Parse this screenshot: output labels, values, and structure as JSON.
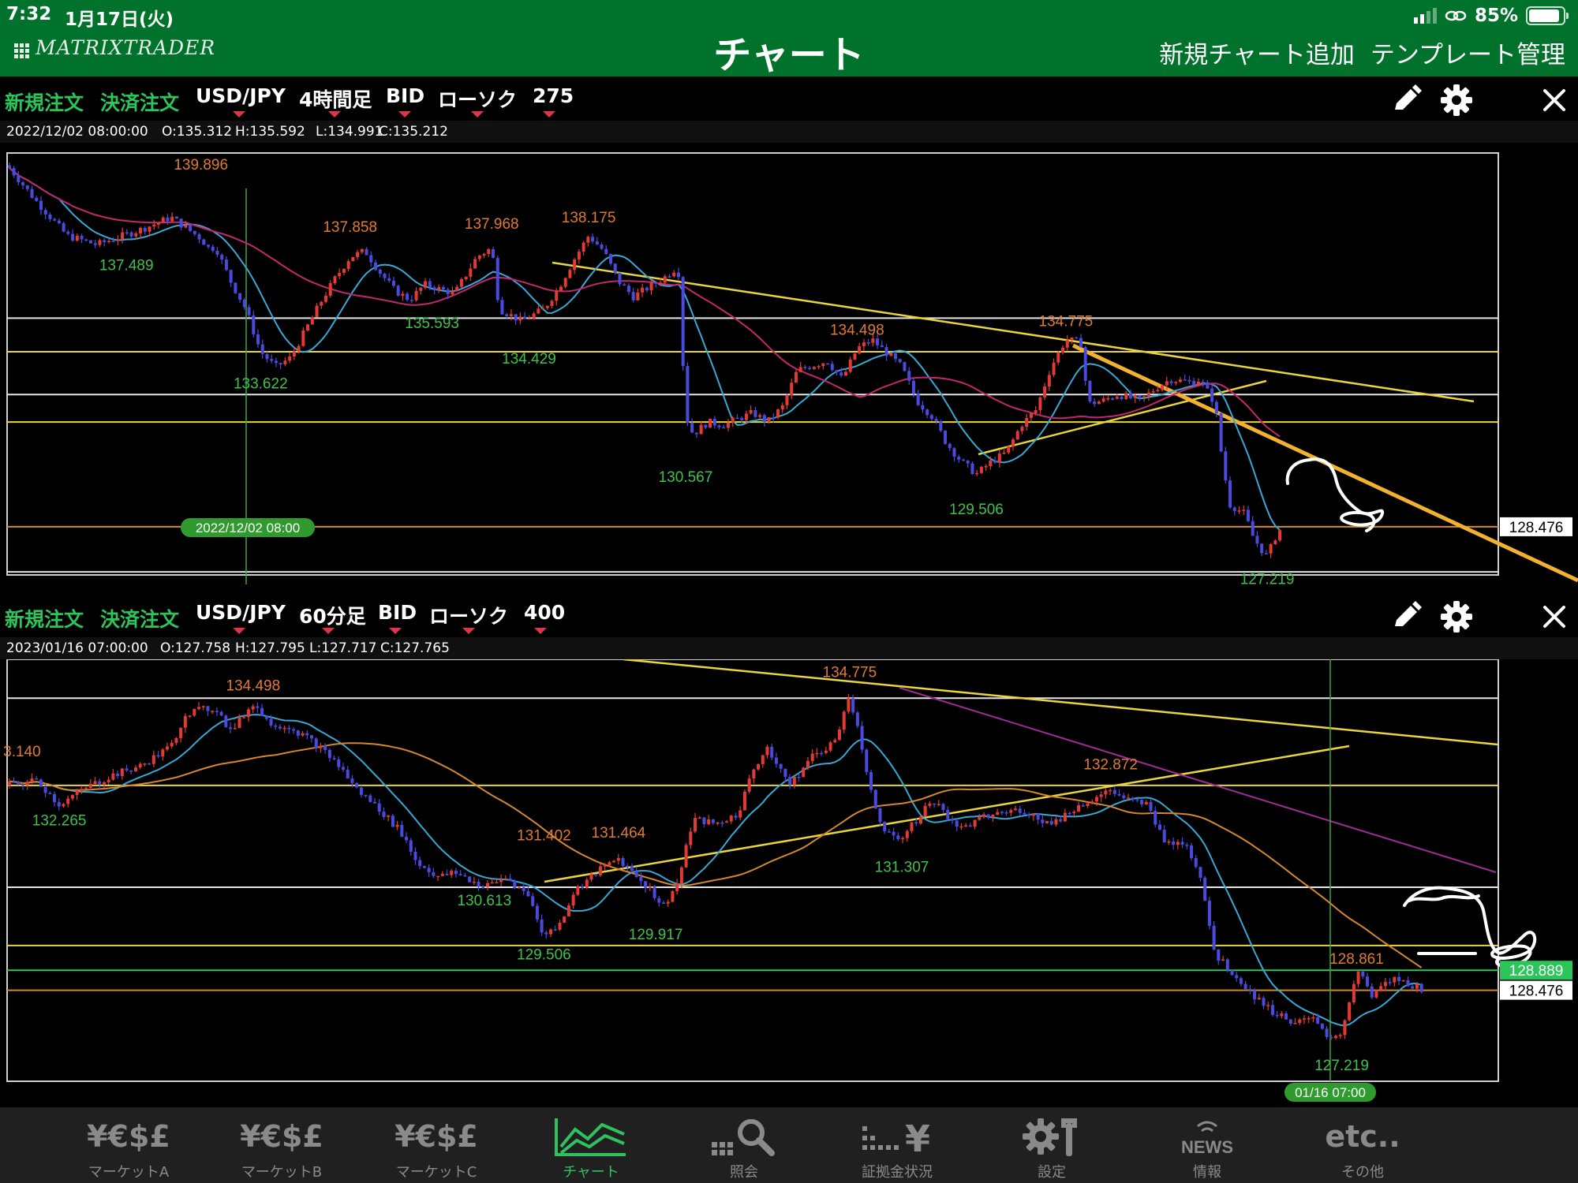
{
  "status_bar": {
    "time": "7:32",
    "date": "1月17日(火)",
    "battery": "85%"
  },
  "header": {
    "logo": "MATRIXTRADER",
    "title": "チャート",
    "add_chart": "新規チャート追加",
    "template": "テンプレート管理"
  },
  "panels": [
    {
      "toolbar": {
        "new_order": "新規注文",
        "settle_order": "決済注文",
        "pair": "USD/JPY",
        "timeframe": "4時間足",
        "price_type": "BID",
        "chart_type": "ローソク",
        "count": "275"
      },
      "ohlc": {
        "datetime": "2022/12/02 08:00:00",
        "open": "O:135.312",
        "high": "H:135.592",
        "low": "L:134.991",
        "close": "C:135.212"
      },
      "cursor_label": "2022/12/02 08:00",
      "price_tags": [
        "128.476"
      ],
      "highs": [
        "139.896",
        "137.858",
        "137.968",
        "138.175",
        "134.498",
        "134.775"
      ],
      "lows": [
        "137.489",
        "133.622",
        "135.593",
        "134.429",
        "130.567",
        "129.506",
        "127.219"
      ],
      "chart_data": {
        "type": "candlestick",
        "y_unit": "USD/JPY",
        "x_start": "2022/11/21",
        "x_end": "2023/01/16",
        "ylim": [
          126.9,
          140.7
        ],
        "horizontal_lines": [
          {
            "price": 135.3,
            "color": "#e6e6e6"
          },
          {
            "price": 134.2,
            "color": "#e8d63a"
          },
          {
            "price": 132.8,
            "color": "#e6e6e6"
          },
          {
            "price": 131.9,
            "color": "#e8d63a"
          },
          {
            "price": 128.476,
            "color": "#d4882b"
          },
          {
            "price": 127.0,
            "color": "#e6e6e6"
          }
        ],
        "close_path": [
          [
            0,
            140.3
          ],
          [
            0.02,
            139.1
          ],
          [
            0.04,
            138.0
          ],
          [
            0.06,
            137.7
          ],
          [
            0.09,
            138.2
          ],
          [
            0.11,
            138.6
          ],
          [
            0.13,
            137.9
          ],
          [
            0.135,
            137.6
          ],
          [
            0.14,
            137.6
          ],
          [
            0.15,
            136.5
          ],
          [
            0.16,
            135.6
          ],
          [
            0.17,
            134.2
          ],
          [
            0.18,
            133.7
          ],
          [
            0.19,
            134.0
          ],
          [
            0.21,
            135.8
          ],
          [
            0.22,
            136.6
          ],
          [
            0.23,
            137.3
          ],
          [
            0.24,
            137.5
          ],
          [
            0.25,
            136.8
          ],
          [
            0.26,
            136.2
          ],
          [
            0.27,
            135.9
          ],
          [
            0.28,
            136.4
          ],
          [
            0.3,
            136.1
          ],
          [
            0.315,
            137.3
          ],
          [
            0.325,
            137.6
          ],
          [
            0.33,
            135.6
          ],
          [
            0.345,
            135.2
          ],
          [
            0.36,
            135.6
          ],
          [
            0.37,
            136.3
          ],
          [
            0.38,
            137.2
          ],
          [
            0.39,
            138.0
          ],
          [
            0.4,
            137.5
          ],
          [
            0.41,
            136.5
          ],
          [
            0.42,
            136.0
          ],
          [
            0.44,
            136.6
          ],
          [
            0.45,
            137.0
          ],
          [
            0.455,
            132.1
          ],
          [
            0.46,
            131.5
          ],
          [
            0.47,
            131.9
          ],
          [
            0.48,
            131.8
          ],
          [
            0.49,
            132.0
          ],
          [
            0.5,
            132.2
          ],
          [
            0.51,
            131.9
          ],
          [
            0.52,
            132.4
          ],
          [
            0.53,
            133.6
          ],
          [
            0.55,
            133.9
          ],
          [
            0.56,
            133.3
          ],
          [
            0.57,
            134.3
          ],
          [
            0.58,
            134.6
          ],
          [
            0.6,
            133.7
          ],
          [
            0.61,
            132.6
          ],
          [
            0.62,
            132.1
          ],
          [
            0.63,
            131.2
          ],
          [
            0.64,
            130.6
          ],
          [
            0.65,
            130.2
          ],
          [
            0.66,
            130.6
          ],
          [
            0.67,
            130.9
          ],
          [
            0.68,
            131.8
          ],
          [
            0.69,
            132.3
          ],
          [
            0.7,
            133.7
          ],
          [
            0.71,
            134.6
          ],
          [
            0.72,
            134.5
          ],
          [
            0.725,
            132.5
          ],
          [
            0.735,
            132.6
          ],
          [
            0.745,
            132.8
          ],
          [
            0.76,
            132.6
          ],
          [
            0.77,
            133.0
          ],
          [
            0.78,
            133.3
          ],
          [
            0.795,
            133.2
          ],
          [
            0.8,
            133.3
          ],
          [
            0.81,
            132.5
          ],
          [
            0.815,
            130.6
          ],
          [
            0.82,
            129.2
          ],
          [
            0.83,
            128.9
          ],
          [
            0.835,
            128.2
          ],
          [
            0.84,
            127.8
          ],
          [
            0.845,
            127.5
          ],
          [
            0.85,
            128.1
          ],
          [
            0.855,
            128.476
          ]
        ],
        "swing_highs": [
          {
            "x": 0.13,
            "price": 139.896
          },
          {
            "x": 0.23,
            "price": 137.858
          },
          {
            "x": 0.325,
            "price": 137.968
          },
          {
            "x": 0.39,
            "price": 138.175
          },
          {
            "x": 0.57,
            "price": 134.498
          },
          {
            "x": 0.71,
            "price": 134.775
          }
        ],
        "swing_lows": [
          {
            "x": 0.08,
            "price": 137.489
          },
          {
            "x": 0.17,
            "price": 133.622
          },
          {
            "x": 0.285,
            "price": 135.593
          },
          {
            "x": 0.35,
            "price": 134.429
          },
          {
            "x": 0.455,
            "price": 130.567
          },
          {
            "x": 0.65,
            "price": 129.506
          },
          {
            "x": 0.845,
            "price": 127.219
          }
        ]
      }
    },
    {
      "toolbar": {
        "new_order": "新規注文",
        "settle_order": "決済注文",
        "pair": "USD/JPY",
        "timeframe": "60分足",
        "price_type": "BID",
        "chart_type": "ローソク",
        "count": "400"
      },
      "ohlc": {
        "datetime": "2023/01/16 07:00:00",
        "open": "O:127.758",
        "high": "H:127.795",
        "low": "L:127.717",
        "close": "C:127.765"
      },
      "cursor_label": "01/16 07:00",
      "price_tags": [
        "128.889",
        "128.476"
      ],
      "highs": [
        "3.140",
        "134.498",
        "131.402",
        "131.464",
        "134.775",
        "132.872",
        "128.861"
      ],
      "lows": [
        "132.265",
        "130.613",
        "129.506",
        "129.917",
        "131.307",
        "127.219"
      ],
      "chart_data": {
        "type": "candlestick",
        "y_unit": "USD/JPY",
        "x_start": "2022/12/27",
        "x_end": "2023/01/16",
        "ylim": [
          126.6,
          135.3
        ],
        "horizontal_lines": [
          {
            "price": 134.5,
            "color": "#e6e6e6"
          },
          {
            "price": 132.7,
            "color": "#e8d63a"
          },
          {
            "price": 130.6,
            "color": "#e6e6e6"
          },
          {
            "price": 129.4,
            "color": "#e8d63a"
          },
          {
            "price": 128.889,
            "color": "#2cc55a"
          },
          {
            "price": 128.476,
            "color": "#d4882b"
          }
        ],
        "close_path": [
          [
            0,
            132.7
          ],
          [
            0.02,
            132.8
          ],
          [
            0.035,
            132.3
          ],
          [
            0.05,
            132.6
          ],
          [
            0.07,
            132.9
          ],
          [
            0.09,
            133.1
          ],
          [
            0.11,
            133.5
          ],
          [
            0.12,
            134.2
          ],
          [
            0.14,
            134.3
          ],
          [
            0.15,
            133.8
          ],
          [
            0.165,
            134.4
          ],
          [
            0.175,
            134.0
          ],
          [
            0.19,
            133.9
          ],
          [
            0.205,
            133.6
          ],
          [
            0.22,
            133.2
          ],
          [
            0.235,
            132.6
          ],
          [
            0.25,
            132.2
          ],
          [
            0.265,
            131.7
          ],
          [
            0.275,
            131.1
          ],
          [
            0.29,
            130.8
          ],
          [
            0.3,
            130.9
          ],
          [
            0.32,
            130.6
          ],
          [
            0.335,
            130.8
          ],
          [
            0.35,
            130.4
          ],
          [
            0.36,
            129.6
          ],
          [
            0.37,
            129.8
          ],
          [
            0.38,
            130.5
          ],
          [
            0.395,
            130.9
          ],
          [
            0.41,
            131.2
          ],
          [
            0.43,
            130.6
          ],
          [
            0.44,
            130.2
          ],
          [
            0.45,
            130.7
          ],
          [
            0.46,
            132.0
          ],
          [
            0.475,
            131.9
          ],
          [
            0.49,
            132.1
          ],
          [
            0.5,
            133.0
          ],
          [
            0.51,
            133.5
          ],
          [
            0.525,
            132.7
          ],
          [
            0.54,
            133.3
          ],
          [
            0.555,
            133.6
          ],
          [
            0.565,
            134.6
          ],
          [
            0.575,
            133.2
          ],
          [
            0.585,
            131.9
          ],
          [
            0.6,
            131.6
          ],
          [
            0.61,
            132.0
          ],
          [
            0.62,
            132.4
          ],
          [
            0.64,
            131.8
          ],
          [
            0.66,
            132.1
          ],
          [
            0.68,
            132.2
          ],
          [
            0.7,
            131.9
          ],
          [
            0.72,
            132.3
          ],
          [
            0.74,
            132.6
          ],
          [
            0.75,
            132.4
          ],
          [
            0.765,
            132.3
          ],
          [
            0.775,
            131.6
          ],
          [
            0.79,
            131.5
          ],
          [
            0.8,
            130.9
          ],
          [
            0.81,
            129.2
          ],
          [
            0.82,
            128.9
          ],
          [
            0.835,
            128.4
          ],
          [
            0.85,
            128.0
          ],
          [
            0.865,
            127.8
          ],
          [
            0.875,
            127.9
          ],
          [
            0.885,
            127.5
          ],
          [
            0.895,
            127.6
          ],
          [
            0.905,
            128.9
          ],
          [
            0.915,
            128.4
          ],
          [
            0.93,
            128.7
          ],
          [
            0.94,
            128.6
          ],
          [
            0.95,
            128.5
          ]
        ],
        "swing_highs": [
          {
            "x": 0.01,
            "price": 133.14
          },
          {
            "x": 0.165,
            "price": 134.498
          },
          {
            "x": 0.36,
            "price": 131.402
          },
          {
            "x": 0.41,
            "price": 131.464
          },
          {
            "x": 0.565,
            "price": 134.775
          },
          {
            "x": 0.74,
            "price": 132.872
          },
          {
            "x": 0.905,
            "price": 128.861
          }
        ],
        "swing_lows": [
          {
            "x": 0.035,
            "price": 132.265
          },
          {
            "x": 0.32,
            "price": 130.613
          },
          {
            "x": 0.36,
            "price": 129.506
          },
          {
            "x": 0.435,
            "price": 129.917
          },
          {
            "x": 0.6,
            "price": 131.307
          },
          {
            "x": 0.895,
            "price": 127.219
          }
        ]
      }
    }
  ],
  "tabbar": {
    "tabs": [
      {
        "label": "マーケットA",
        "icon": "¥€$£",
        "icon_name": "currency-icon",
        "active": false
      },
      {
        "label": "マーケットB",
        "icon": "¥€$£",
        "icon_name": "currency-icon",
        "active": false
      },
      {
        "label": "マーケットC",
        "icon": "¥€$£",
        "icon_name": "currency-icon",
        "active": false
      },
      {
        "label": "チャート",
        "icon": "",
        "icon_name": "chart-icon",
        "active": true
      },
      {
        "label": "照会",
        "icon": "",
        "icon_name": "search-icon",
        "active": false
      },
      {
        "label": "証拠金状況",
        "icon": "¥",
        "icon_name": "margin-chart-icon",
        "active": false
      },
      {
        "label": "設定",
        "icon": "",
        "icon_name": "settings-icon",
        "active": false
      },
      {
        "label": "情報",
        "icon": "NEWS",
        "icon_name": "news-icon",
        "active": false
      },
      {
        "label": "その他",
        "icon": "etc..",
        "icon_name": "etc-icon",
        "active": false
      }
    ]
  },
  "colors": {
    "header_green": "#01722b",
    "order_green": "#2cc55a",
    "candle_up": "#e33a33",
    "candle_down": "#4a4ae0",
    "ma_short": "#37a8d6",
    "ma_long_top": "#c4266f",
    "ma_long_bottom": "#d4882b",
    "trendline": "#e8d63a",
    "drawn_trendline": "#f2b230",
    "caret": "#e0344c"
  }
}
